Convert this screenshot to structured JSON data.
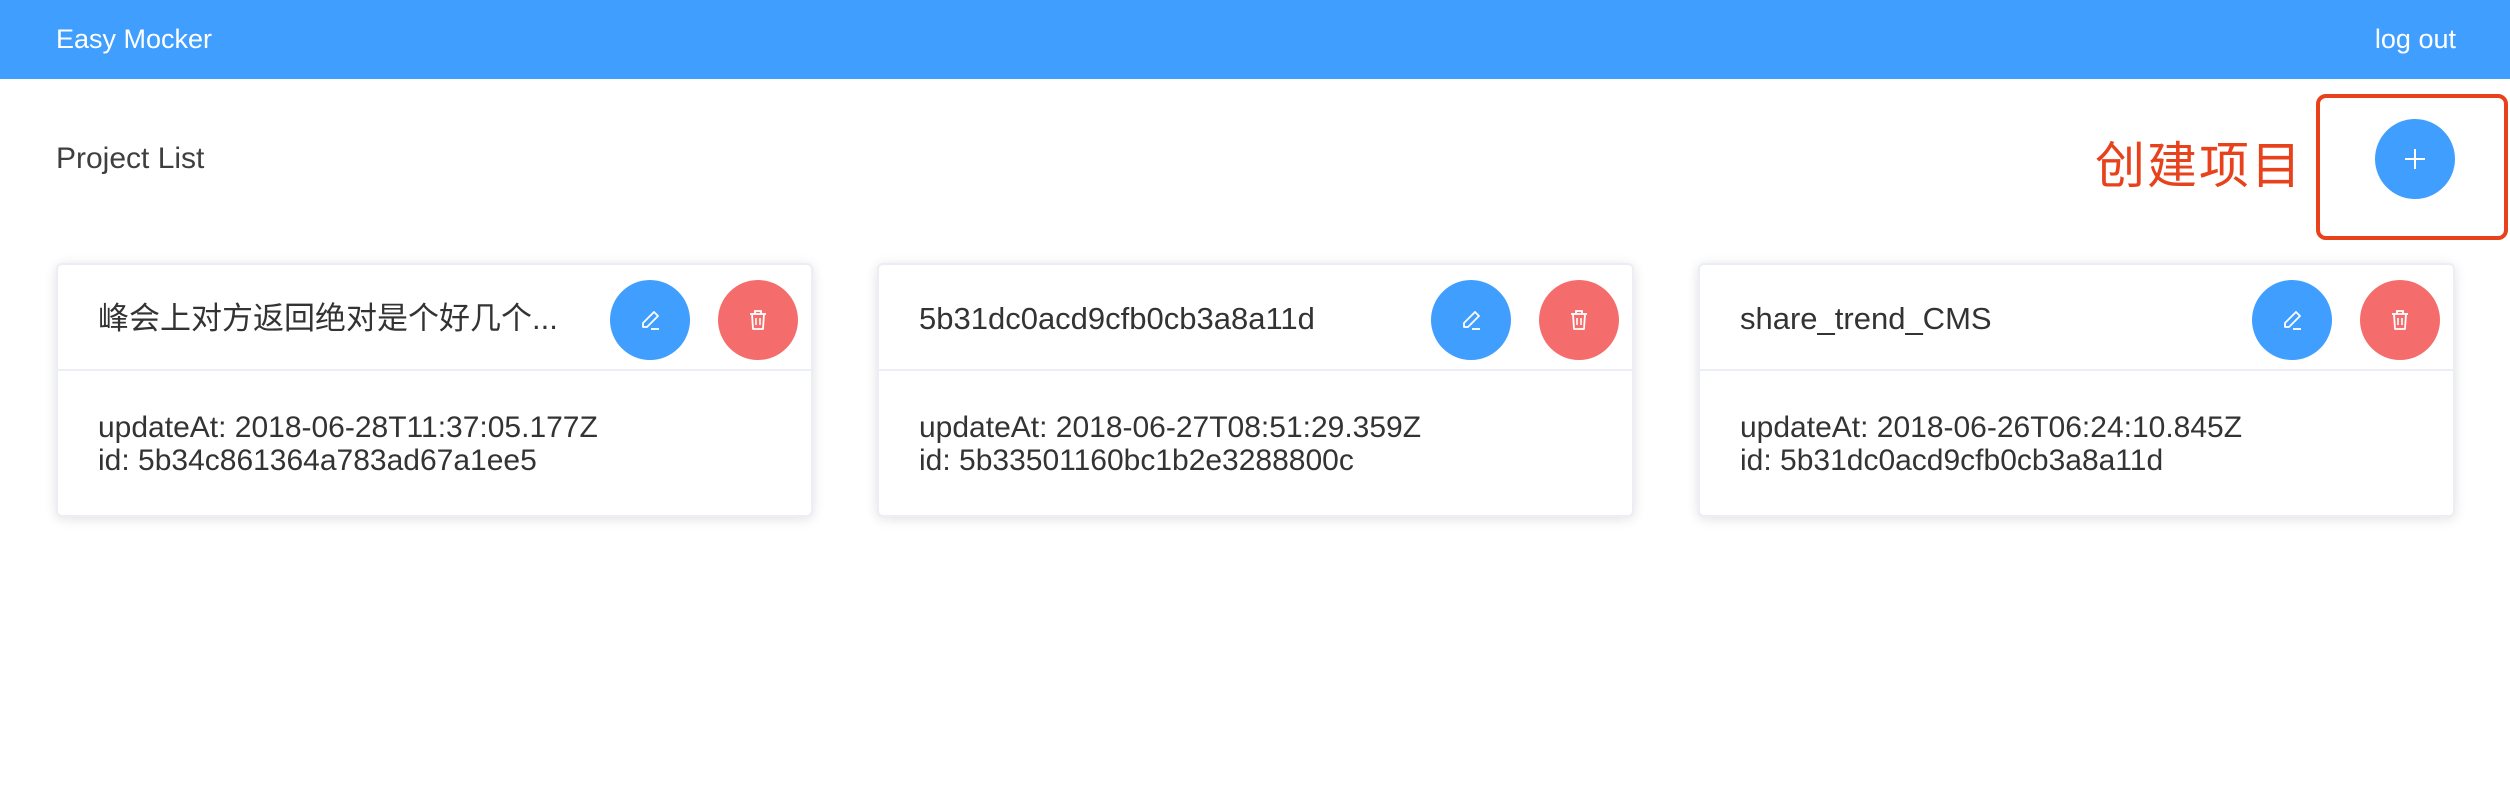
{
  "header": {
    "brand": "Easy Mocker",
    "logout_label": "log out"
  },
  "main": {
    "title": "Project List",
    "annotation": "创建项目",
    "add_button_icon": "plus-icon"
  },
  "colors": {
    "primary": "#409eff",
    "danger": "#f56c6c",
    "annotation": "#e8421d"
  },
  "projects": [
    {
      "name": "峰会上对方返回绝对是个好几个...",
      "updateAt": "updateAt: 2018-06-28T11:37:05.177Z",
      "id": "id: 5b34c861364a783ad67a1ee5"
    },
    {
      "name": "5b31dc0acd9cfb0cb3a8a11d",
      "updateAt": "updateAt: 2018-06-27T08:51:29.359Z",
      "id": "id: 5b33501160bc1b2e3288800c"
    },
    {
      "name": "share_trend_CMS",
      "updateAt": "updateAt: 2018-06-26T06:24:10.845Z",
      "id": "id: 5b31dc0acd9cfb0cb3a8a11d"
    }
  ]
}
